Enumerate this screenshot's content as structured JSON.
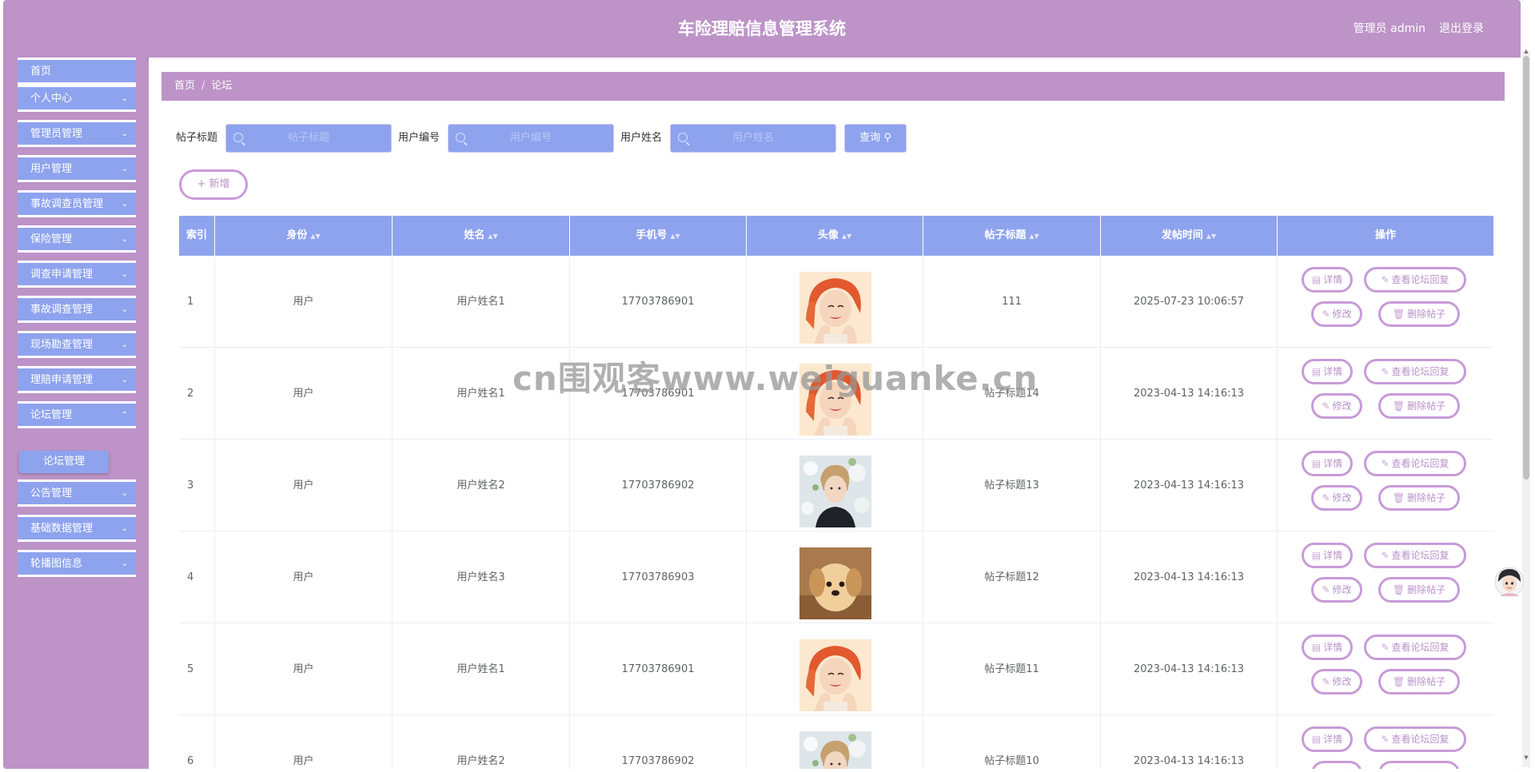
{
  "header": {
    "title": "车险理赔信息管理系统",
    "user_label": "管理员 admin",
    "logout_label": "退出登录"
  },
  "sidebar": {
    "items": [
      {
        "label": "首页",
        "chevron": false
      },
      {
        "label": "个人中心",
        "chevron": true
      },
      {
        "label": "管理员管理",
        "chevron": true
      },
      {
        "label": "用户管理",
        "chevron": true
      },
      {
        "label": "事故调查员管理",
        "chevron": true
      },
      {
        "label": "保险管理",
        "chevron": true
      },
      {
        "label": "调查申请管理",
        "chevron": true
      },
      {
        "label": "事故调查管理",
        "chevron": true
      },
      {
        "label": "现场勘查管理",
        "chevron": true
      },
      {
        "label": "理赔申请管理",
        "chevron": true
      },
      {
        "label": "论坛管理",
        "chevron": true
      },
      {
        "label": "公告管理",
        "chevron": true
      },
      {
        "label": "基础数据管理",
        "chevron": true
      },
      {
        "label": "轮播图信息",
        "chevron": true
      }
    ],
    "active_sub_item": "论坛管理"
  },
  "breadcrumb": {
    "home": "首页",
    "separator": "/",
    "current": "论坛"
  },
  "search": {
    "fields": [
      {
        "label": "帖子标题",
        "placeholder": "帖子标题"
      },
      {
        "label": "用户编号",
        "placeholder": "用户编号"
      },
      {
        "label": "用户姓名",
        "placeholder": "用户姓名"
      }
    ],
    "query_label": "查询"
  },
  "add_button": "新增",
  "table": {
    "columns": [
      "索引",
      "身份",
      "姓名",
      "手机号",
      "头像",
      "帖子标题",
      "发帖时间",
      "操作"
    ],
    "rows": [
      {
        "index": "1",
        "identity": "用户",
        "name": "用户姓名1",
        "phone": "17703786901",
        "avatar": "woman-smiling",
        "title": "111",
        "time": "2025-07-23 10:06:57"
      },
      {
        "index": "2",
        "identity": "用户",
        "name": "用户姓名1",
        "phone": "17703786901",
        "avatar": "woman-smiling",
        "title": "帖子标题14",
        "time": "2023-04-13 14:16:13"
      },
      {
        "index": "3",
        "identity": "用户",
        "name": "用户姓名2",
        "phone": "17703786902",
        "avatar": "man-flowers",
        "title": "帖子标题13",
        "time": "2023-04-13 14:16:13"
      },
      {
        "index": "4",
        "identity": "用户",
        "name": "用户姓名3",
        "phone": "17703786903",
        "avatar": "puppy",
        "title": "帖子标题12",
        "time": "2023-04-13 14:16:13"
      },
      {
        "index": "5",
        "identity": "用户",
        "name": "用户姓名1",
        "phone": "17703786901",
        "avatar": "woman-smiling",
        "title": "帖子标题11",
        "time": "2023-04-13 14:16:13"
      },
      {
        "index": "6",
        "identity": "用户",
        "name": "用户姓名2",
        "phone": "17703786902",
        "avatar": "man-flowers",
        "title": "帖子标题10",
        "time": "2023-04-13 14:16:13"
      }
    ],
    "actions": {
      "detail": "详情",
      "view_replies": "查看论坛回复",
      "edit": "修改",
      "delete": "删除帖子"
    }
  },
  "watermark": "cn围观客www.weiguanke.cn",
  "colors": {
    "primary_purple": "#bd93c8",
    "accent_blue": "#8ea3ee",
    "button_border": "#c89bd8"
  }
}
